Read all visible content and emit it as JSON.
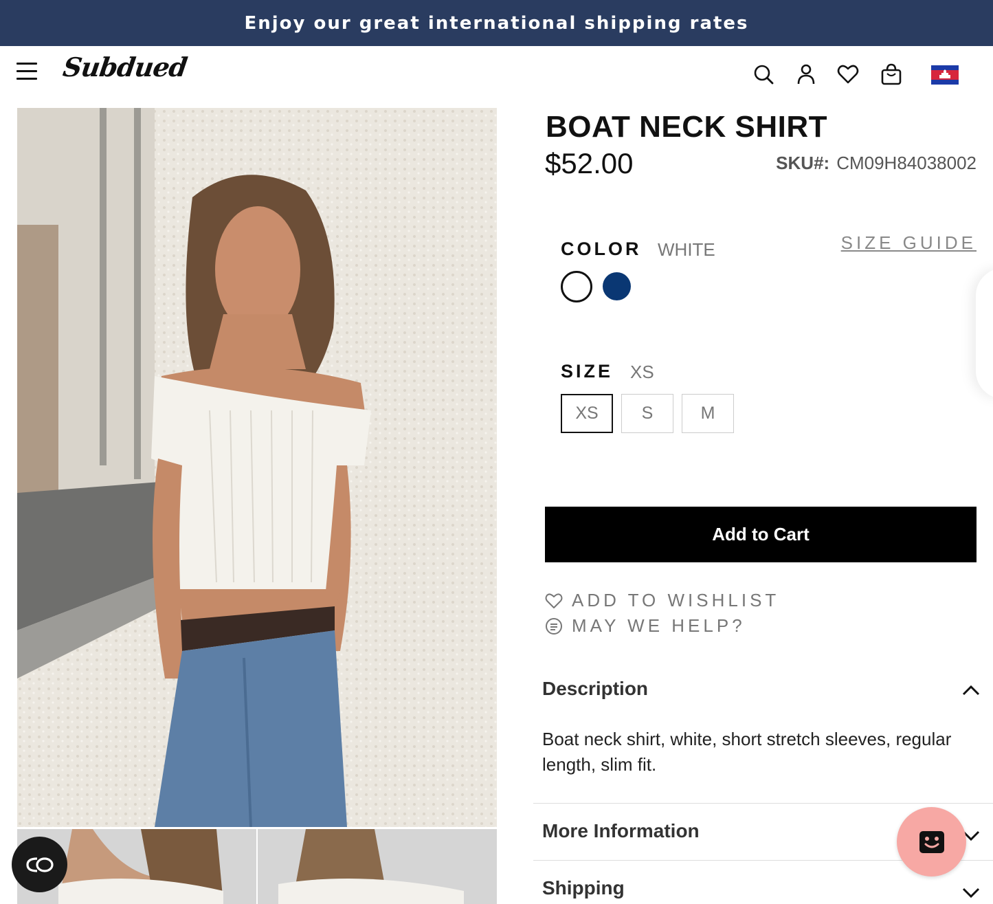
{
  "banner": {
    "text": "Enjoy our great international shipping rates"
  },
  "header": {
    "logo_text": "Subdued",
    "icons": [
      "menu-icon",
      "search-icon",
      "account-icon",
      "wishlist-heart-icon",
      "shopping-bag-icon",
      "cambodia-flag-icon"
    ]
  },
  "product": {
    "title": "BOAT NECK SHIRT",
    "price": "$52.00",
    "sku_label": "SKU#:",
    "sku_value": "CM09H84038002"
  },
  "color": {
    "label": "COLOR",
    "selected": "WHITE",
    "size_guide": "SIZE GUIDE",
    "swatches": [
      "#ffffff",
      "#0a3773"
    ]
  },
  "size": {
    "label": "SIZE",
    "selected": "XS",
    "options": [
      "XS",
      "S",
      "M"
    ]
  },
  "actions": {
    "add_to_cart": "Add to Cart",
    "wishlist": "ADD TO WISHLIST",
    "help": "MAY WE HELP?"
  },
  "accordion": {
    "description_title": "Description",
    "description_text": "Boat neck shirt, white, short stretch sleeves, regular length, slim fit.",
    "more_info_title": "More Information",
    "shipping_title": "Shipping"
  },
  "fabs": {
    "co_label": "CO"
  },
  "colors": {
    "banner_bg": "#2a3c60",
    "cart_bg": "#000000",
    "chat_bg": "#f7a8a4",
    "navy": "#0a3773"
  }
}
